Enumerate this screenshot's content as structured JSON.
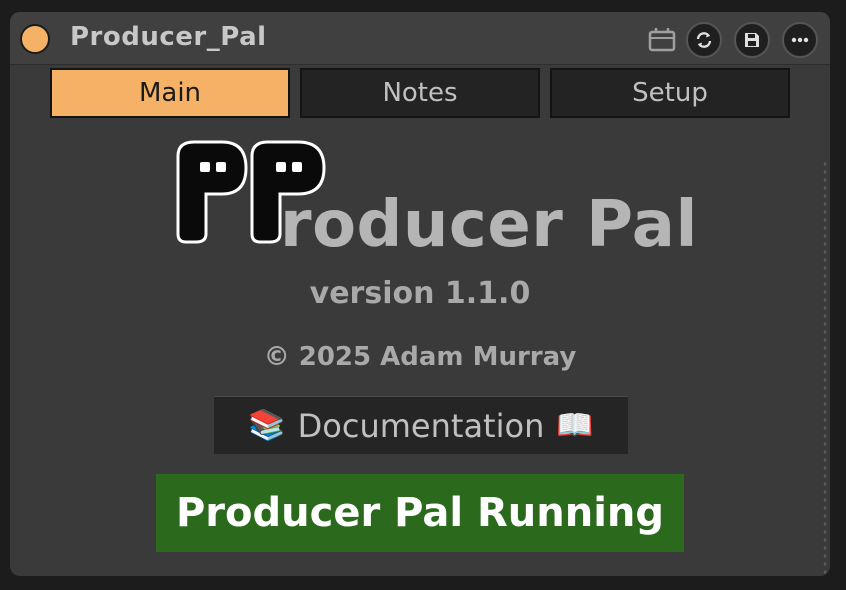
{
  "titlebar": {
    "title": "Producer_Pal",
    "icons": [
      "power-toggle",
      "device-icon",
      "refresh-icon",
      "save-icon",
      "more-icon"
    ]
  },
  "tabs": [
    {
      "label": "Main",
      "active": true
    },
    {
      "label": "Notes",
      "active": false
    },
    {
      "label": "Setup",
      "active": false
    }
  ],
  "main": {
    "logo_letters": "P",
    "app_name": "roducer Pal",
    "version": "version 1.1.0",
    "copyright": "© 2025 Adam Murray",
    "doc_button": {
      "label": "Documentation",
      "left_emoji": "📚",
      "right_emoji": "📖"
    },
    "status": "Producer Pal Running"
  },
  "colors": {
    "accent": "#f5b266",
    "panel": "#3a3a3a",
    "status_green": "#2b6a1c"
  }
}
